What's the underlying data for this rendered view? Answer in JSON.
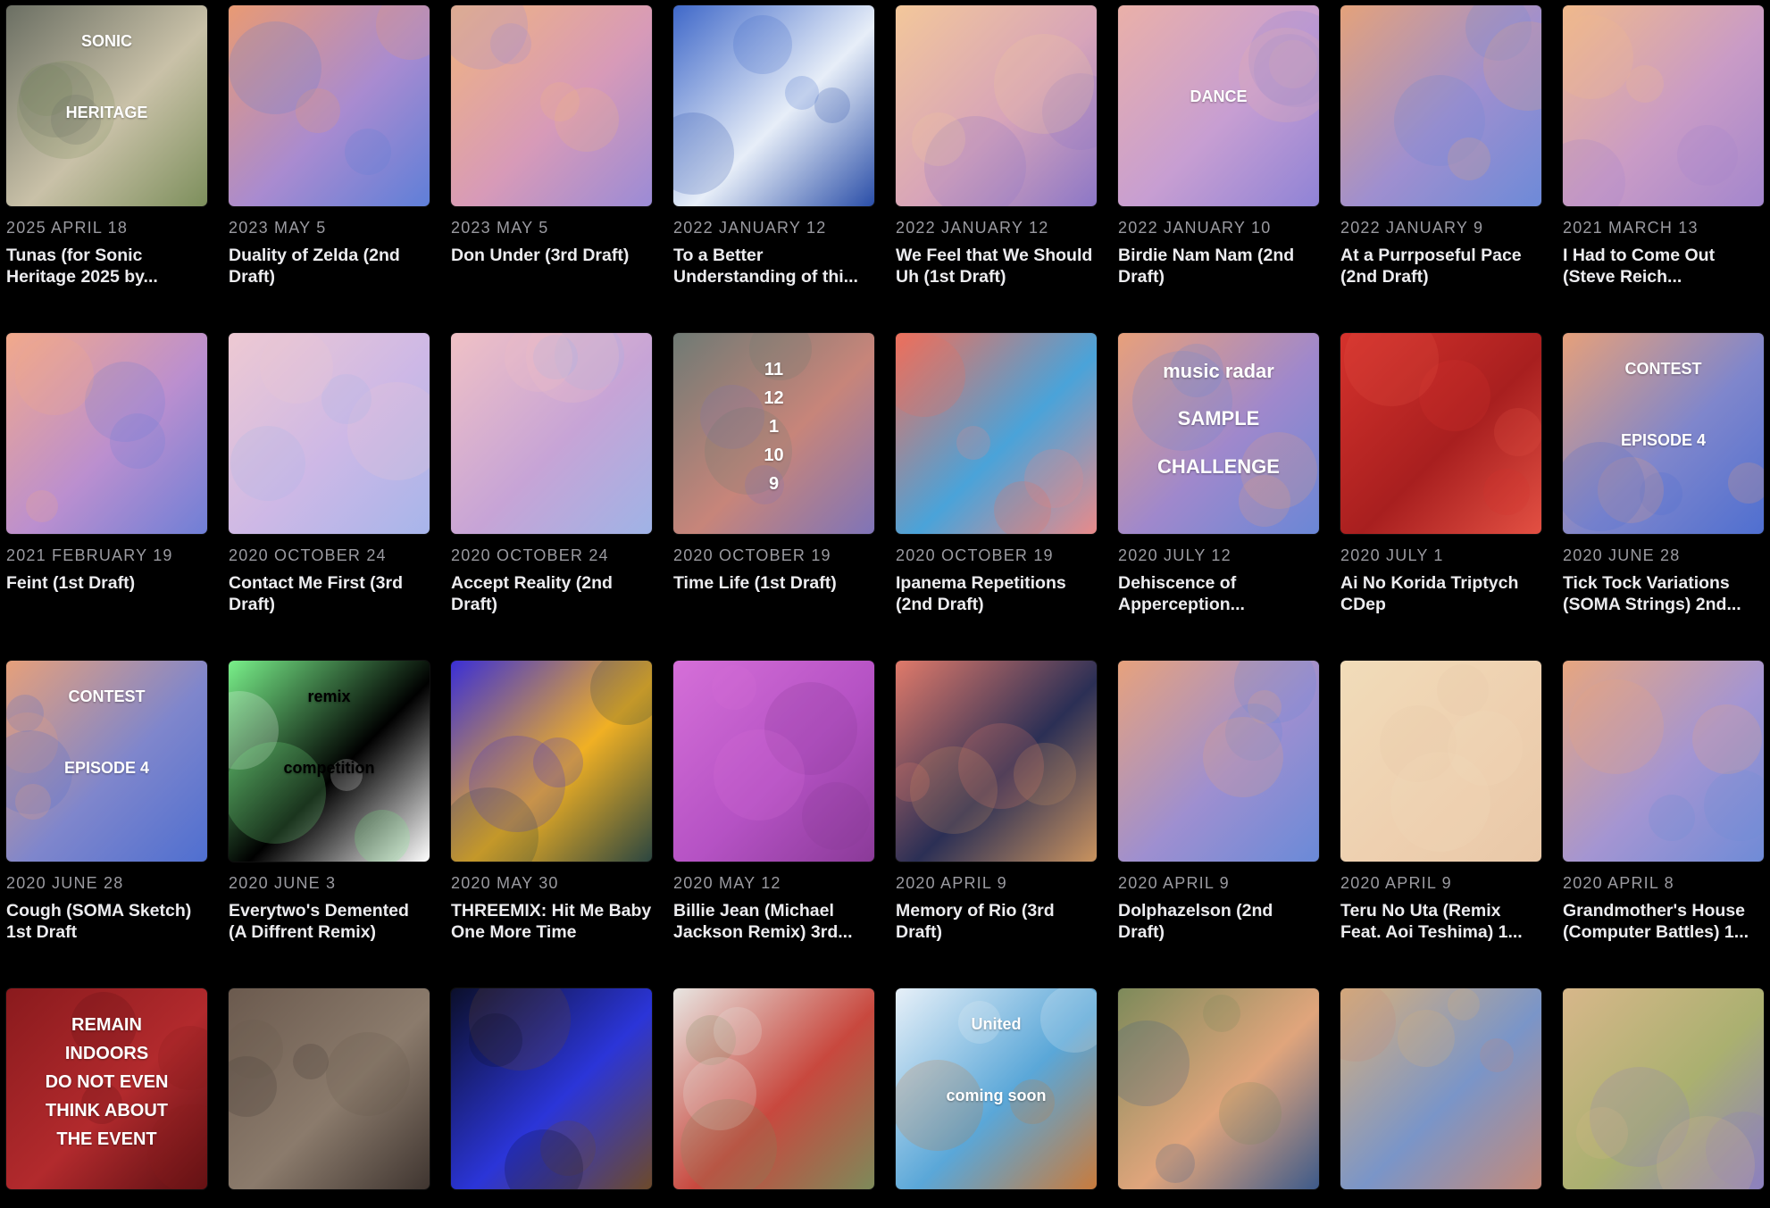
{
  "tracks": [
    {
      "date": "2025 APRIL 18",
      "title": "Tunas (for Sonic Heritage 2025 by...",
      "art_text": [
        "SONIC",
        "HERITAGE"
      ],
      "colors": [
        "#6b6f63",
        "#c9c1a8",
        "#7d8f5c"
      ]
    },
    {
      "date": "2023 MAY 5",
      "title": "Duality of Zelda (2nd Draft)",
      "colors": [
        "#e99a73",
        "#a98bd0",
        "#5f7fd8"
      ]
    },
    {
      "date": "2023 MAY 5",
      "title": "Don Under (3rd Draft)",
      "colors": [
        "#f0b47f",
        "#d79ab8",
        "#9b8bd6"
      ]
    },
    {
      "date": "2022 JANUARY 12",
      "title": "To a Better Understanding of thi...",
      "colors": [
        "#3f68c9",
        "#e7eef8",
        "#2a4ea8"
      ]
    },
    {
      "date": "2022 JANUARY 12",
      "title": "We Feel that We Should Uh (1st Draft)",
      "colors": [
        "#f3c79a",
        "#d7a4b9",
        "#8c77c7"
      ]
    },
    {
      "date": "2022 JANUARY 10",
      "title": "Birdie Nam Nam (2nd Draft)",
      "art_text": [
        "DANCE"
      ],
      "colors": [
        "#eab0a8",
        "#c79ed2",
        "#8f83d6"
      ]
    },
    {
      "date": "2022 JANUARY 9",
      "title": "At a Purrposeful Pace (2nd Draft)",
      "colors": [
        "#e4a27a",
        "#9f8fcf",
        "#6d8ad8"
      ]
    },
    {
      "date": "2021 MARCH 13",
      "title": "I Had to Come Out (Steve Reich...",
      "colors": [
        "#f0b98b",
        "#c99bc6",
        "#a386cd"
      ]
    },
    {
      "date": "2021 FEBRUARY 19",
      "title": "Feint (1st Draft)",
      "colors": [
        "#f2a98a",
        "#bb8fcf",
        "#6f7fd6"
      ]
    },
    {
      "date": "2020 OCTOBER 24",
      "title": "Contact Me First (3rd Draft)",
      "colors": [
        "#eec9d2",
        "#cdb8e6",
        "#a7b5ea"
      ]
    },
    {
      "date": "2020 OCTOBER 24",
      "title": "Accept Reality (2nd Draft)",
      "colors": [
        "#f0c1c5",
        "#c7a4d6",
        "#9fb3e6"
      ]
    },
    {
      "date": "2020 OCTOBER 19",
      "title": "Time Life (1st Draft)",
      "art_text": [
        "11",
        "12",
        "1",
        "10",
        "9"
      ],
      "colors": [
        "#6f7a74",
        "#c7857a",
        "#7f74b8"
      ]
    },
    {
      "date": "2020 OCTOBER 19",
      "title": "Ipanema Repetitions (2nd Draft)",
      "colors": [
        "#ef6f5a",
        "#4aa3d9",
        "#e98a8a"
      ]
    },
    {
      "date": "2020 JULY 12",
      "title": "Dehiscence of Apperception...",
      "art_text": [
        "music radar",
        "SAMPLE",
        "CHALLENGE"
      ],
      "colors": [
        "#e8a07a",
        "#9f88cc",
        "#6a87d6"
      ]
    },
    {
      "date": "2020 JULY 1",
      "title": "Ai No Korida Triptych CDep",
      "colors": [
        "#d5322c",
        "#a81f1f",
        "#e35043"
      ]
    },
    {
      "date": "2020 JUNE 28",
      "title": "Tick Tock Variations (SOMA Strings) 2nd...",
      "art_text": [
        "CONTEST",
        "EPISODE 4"
      ],
      "colors": [
        "#e6a07a",
        "#7f86cc",
        "#4f6fd0"
      ]
    },
    {
      "date": "2020 JUNE 28",
      "title": "Cough (SOMA Sketch) 1st Draft",
      "art_text": [
        "CONTEST",
        "EPISODE 4"
      ],
      "colors": [
        "#e6a07a",
        "#7f86cc",
        "#4f6fd0"
      ]
    },
    {
      "date": "2020 JUNE 3",
      "title": "Everytwo's Demented (A Diffrent Remix)",
      "art_text": [
        "remix",
        "competition"
      ],
      "colors": [
        "#79f08a",
        "#000000",
        "#ffffff"
      ]
    },
    {
      "date": "2020 MAY 30",
      "title": "THREEMIX: Hit Me Baby One More Time",
      "colors": [
        "#3a2fd6",
        "#f0b024",
        "#2b4640"
      ]
    },
    {
      "date": "2020 MAY 12",
      "title": "Billie Jean (Michael Jackson Remix) 3rd...",
      "colors": [
        "#d56fd8",
        "#b552c4",
        "#8a3a98"
      ]
    },
    {
      "date": "2020 APRIL 9",
      "title": "Memory of Rio (3rd Draft)",
      "colors": [
        "#e07a6a",
        "#2b2f55",
        "#c9935f"
      ]
    },
    {
      "date": "2020 APRIL 9",
      "title": "Dolphazelson (2nd Draft)",
      "colors": [
        "#e7a27c",
        "#9e8fd0",
        "#6a8ad8"
      ]
    },
    {
      "date": "2020 APRIL 9",
      "title": "Teru No Uta (Remix Feat. Aoi Teshima) 1...",
      "colors": [
        "#f1dcb9",
        "#eed0b0",
        "#e9c8a8"
      ]
    },
    {
      "date": "2020 APRIL 8",
      "title": "Grandmother's House (Computer Battles) 1...",
      "colors": [
        "#e7a67f",
        "#a495d2",
        "#6f8bd7"
      ]
    },
    {
      "date": "",
      "title": "",
      "art_text": [
        "REMAIN",
        "INDOORS",
        "DO NOT EVEN",
        "THINK ABOUT",
        "THE EVENT"
      ],
      "colors": [
        "#8a1a1d",
        "#b22a2d",
        "#5a0f12"
      ]
    },
    {
      "date": "",
      "title": "",
      "colors": [
        "#6b5a4e",
        "#8b7b6c",
        "#3f3530"
      ]
    },
    {
      "date": "",
      "title": "",
      "colors": [
        "#0b0f2a",
        "#2b35d8",
        "#6d4a2a"
      ]
    },
    {
      "date": "",
      "title": "",
      "colors": [
        "#e8e6e2",
        "#c8483e",
        "#7d8a5a"
      ]
    },
    {
      "date": "",
      "title": "",
      "art_text": [
        "United",
        "coming soon"
      ],
      "colors": [
        "#e7f0f8",
        "#5aa7d8",
        "#c97b3c"
      ]
    },
    {
      "date": "",
      "title": "",
      "colors": [
        "#7d8a5a",
        "#e0a57c",
        "#3d5a8a"
      ]
    },
    {
      "date": "",
      "title": "",
      "colors": [
        "#d8b07b",
        "#7a95c8",
        "#c48a7a"
      ]
    },
    {
      "date": "",
      "title": "",
      "colors": [
        "#d7b78a",
        "#aab070",
        "#8c80c0"
      ]
    }
  ]
}
